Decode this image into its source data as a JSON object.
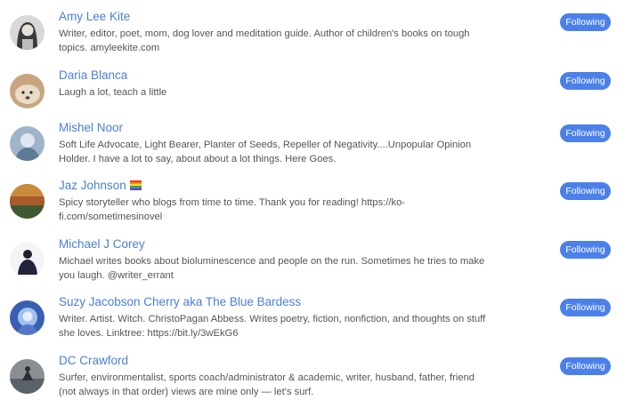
{
  "button_label": "Following",
  "users": [
    {
      "name": "Amy Lee Kite",
      "bio": [
        "Writer, editor, poet, mom, dog lover and meditation guide. Author of children's books on tough",
        "topics. amyleekite.com"
      ]
    },
    {
      "name": "Daria Blanca",
      "bio": [
        "Laugh a lot, teach a little"
      ]
    },
    {
      "name": "Mishel Noor",
      "bio": [
        "Soft Life Advocate, Light Bearer, Planter of Seeds, Repeller of Negativity....Unpopular Opinion",
        "Holder. I have a lot to say, about about a lot things. Here Goes."
      ]
    },
    {
      "name": "Jaz Johnson",
      "bio": [
        "Spicy storyteller who blogs from time to time. Thank you for reading! https://ko-",
        "fi.com/sometimesinovel"
      ]
    },
    {
      "name": "Michael J Corey",
      "bio": [
        "Michael writes books about bioluminescence and people on the run. Sometimes he tries to make",
        "you laugh. @writer_errant"
      ]
    },
    {
      "name": "Suzy Jacobson Cherry aka The Blue Bardess",
      "bio": [
        "Writer. Artist. Witch. ChristoPagan Abbess. Writes poetry, fiction, nonfiction, and thoughts on stuff",
        "she loves. Linktree: https://bit.ly/3wEkG6"
      ]
    },
    {
      "name": "DC Crawford",
      "bio": [
        "Surfer, environmentalist, sports coach/administrator & academic, writer, husband, father, friend",
        "(not always in that order) views are mine only — let's surf."
      ]
    }
  ]
}
